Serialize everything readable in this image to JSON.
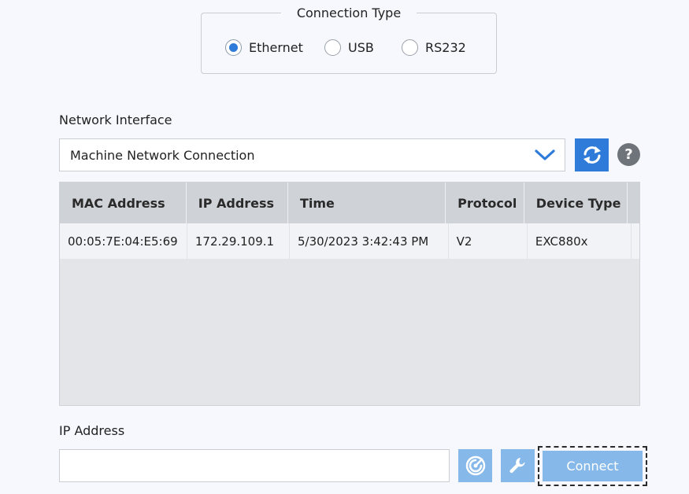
{
  "connection_type": {
    "title": "Connection Type",
    "options": [
      {
        "label": "Ethernet",
        "selected": true
      },
      {
        "label": "USB",
        "selected": false
      },
      {
        "label": "RS232",
        "selected": false
      }
    ]
  },
  "network_interface": {
    "label": "Network Interface",
    "selected": "Machine Network Connection"
  },
  "table": {
    "columns": [
      "MAC Address",
      "IP Address",
      "Time",
      "Protocol",
      "Device Type"
    ],
    "rows": [
      [
        "00:05:7E:04:E5:69",
        "172.29.109.1",
        "5/30/2023 3:42:43 PM",
        "V2",
        "EXC880x"
      ]
    ]
  },
  "ip_address": {
    "label": "IP Address",
    "value": "",
    "placeholder": ""
  },
  "buttons": {
    "help": "?",
    "connect": "Connect"
  },
  "icons": {
    "refresh": "refresh-icon",
    "help": "help-icon",
    "scan": "scan-icon",
    "wrench": "wrench-icon",
    "chevron": "chevron-down-icon"
  },
  "colors": {
    "accent": "#2f7bd9",
    "disabled_button": "#86b9ea",
    "background": "#f6f8fd"
  }
}
